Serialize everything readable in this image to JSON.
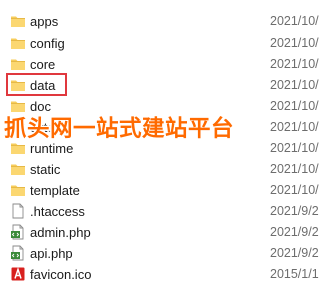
{
  "files": [
    {
      "name": "apps",
      "date": "2021/10/",
      "icon": "folder-icon"
    },
    {
      "name": "config",
      "date": "2021/10/",
      "icon": "folder-icon"
    },
    {
      "name": "core",
      "date": "2021/10/",
      "icon": "folder-icon"
    },
    {
      "name": "data",
      "date": "2021/10/",
      "icon": "folder-icon"
    },
    {
      "name": "doc",
      "date": "2021/10/",
      "icon": "folder-icon"
    },
    {
      "name": "extend",
      "date": "2021/10/",
      "icon": "folder-icon"
    },
    {
      "name": "runtime",
      "date": "2021/10/",
      "icon": "folder-icon"
    },
    {
      "name": "static",
      "date": "2021/10/",
      "icon": "folder-icon"
    },
    {
      "name": "template",
      "date": "2021/10/",
      "icon": "folder-icon"
    },
    {
      "name": ".htaccess",
      "date": "2021/9/2",
      "icon": "file-icon"
    },
    {
      "name": "admin.php",
      "date": "2021/9/2",
      "icon": "php-file-icon"
    },
    {
      "name": "api.php",
      "date": "2021/9/2",
      "icon": "php-file-icon"
    },
    {
      "name": "favicon.ico",
      "date": "2015/1/1",
      "icon": "ico-file-icon"
    }
  ],
  "highlighted_item": "data",
  "highlight_color": "#e0383e",
  "folder_color": "#f7cd5b",
  "watermark": {
    "text": "抓头网一站式建站平台",
    "color": "#ff6a00"
  }
}
